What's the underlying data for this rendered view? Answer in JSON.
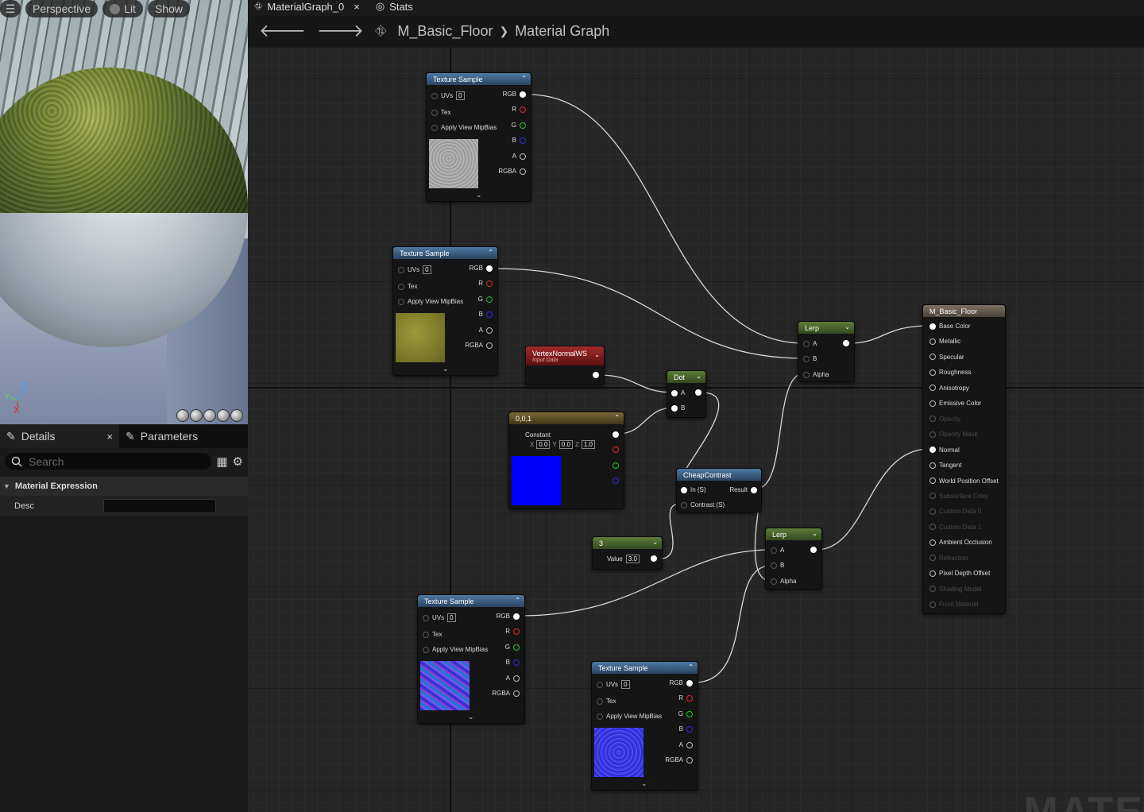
{
  "viewport": {
    "buttons": [
      "Perspective",
      "Lit",
      "Show"
    ],
    "axes": {
      "y": "Y",
      "z": "Z",
      "x": "X"
    }
  },
  "details_panel": {
    "tab_details": "Details",
    "tab_parameters": "Parameters",
    "close": "×",
    "search_placeholder": "Search",
    "section": "Material Expression",
    "prop_label": "Desc"
  },
  "graph_header": {
    "doc_tab": "MaterialGraph_0",
    "doc_tab_close": "×",
    "stats_tab": "Stats",
    "breadcrumb_asset": "M_Basic_Floor",
    "breadcrumb_sep": "❯",
    "breadcrumb_graph": "Material Graph"
  },
  "nodes": {
    "tex1": {
      "title": "Texture Sample",
      "uvs": "UVs",
      "uv_val": "0",
      "tex": "Tex",
      "mip": "Apply View MipBias",
      "outs": [
        "RGB",
        "R",
        "G",
        "B",
        "A",
        "RGBA"
      ]
    },
    "tex2": {
      "title": "Texture Sample",
      "uvs": "UVs",
      "uv_val": "0",
      "tex": "Tex",
      "mip": "Apply View MipBias",
      "outs": [
        "RGB",
        "R",
        "G",
        "B",
        "A",
        "RGBA"
      ]
    },
    "tex3": {
      "title": "Texture Sample",
      "uvs": "UVs",
      "uv_val": "0",
      "tex": "Tex",
      "mip": "Apply View MipBias",
      "outs": [
        "RGB",
        "R",
        "G",
        "B",
        "A",
        "RGBA"
      ]
    },
    "tex4": {
      "title": "Texture Sample",
      "uvs": "UVs",
      "uv_val": "0",
      "tex": "Tex",
      "mip": "Apply View MipBias",
      "outs": [
        "RGB",
        "R",
        "G",
        "B",
        "A",
        "RGBA"
      ]
    },
    "vertex": {
      "title": "VertexNormalWS",
      "subtitle": "Input Data"
    },
    "const3": {
      "title": "0,0,1",
      "label": "Constant",
      "x": "X",
      "xv": "0.0",
      "y": "Y",
      "yv": "0.0",
      "z": "Z",
      "zv": "1.0"
    },
    "dot": {
      "title": "Dot",
      "a": "A",
      "b": "B"
    },
    "contrast": {
      "title": "CheapContrast",
      "in": "In (S)",
      "result": "Result",
      "contrast": "Contrast (S)"
    },
    "scalar": {
      "title": "3",
      "label": "Value",
      "value": "3.0"
    },
    "lerp1": {
      "title": "Lerp",
      "a": "A",
      "b": "B",
      "alpha": "Alpha"
    },
    "lerp2": {
      "title": "Lerp",
      "a": "A",
      "b": "B",
      "alpha": "Alpha"
    },
    "result": {
      "title": "M_Basic_Floor",
      "pins": [
        {
          "label": "Base Color",
          "active": true
        },
        {
          "label": "Metallic",
          "active": true
        },
        {
          "label": "Specular",
          "active": true
        },
        {
          "label": "Roughness",
          "active": true
        },
        {
          "label": "Anisotropy",
          "active": true
        },
        {
          "label": "Emissive Color",
          "active": true
        },
        {
          "label": "Opacity",
          "active": false
        },
        {
          "label": "Opacity Mask",
          "active": false
        },
        {
          "label": "Normal",
          "active": true
        },
        {
          "label": "Tangent",
          "active": true
        },
        {
          "label": "World Position Offset",
          "active": true
        },
        {
          "label": "Subsurface Color",
          "active": false
        },
        {
          "label": "Custom Data 0",
          "active": false
        },
        {
          "label": "Custom Data 1",
          "active": false
        },
        {
          "label": "Ambient Occlusion",
          "active": true
        },
        {
          "label": "Refraction",
          "active": false
        },
        {
          "label": "Pixel Depth Offset",
          "active": true
        },
        {
          "label": "Shading Model",
          "active": false
        },
        {
          "label": "Front Material",
          "active": false
        }
      ]
    }
  },
  "colors": {
    "grid_bg": "#262626",
    "tex_header": "#4e79a1",
    "lerp_header": "#5c7d3a",
    "vertex_header": "#a32a2a",
    "const_header": "#7a6a36",
    "result_header": "#7d6f63"
  },
  "watermark": "MATE"
}
